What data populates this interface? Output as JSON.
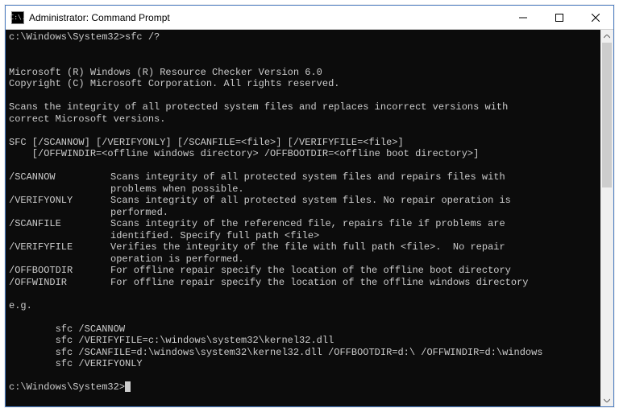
{
  "window": {
    "title": "Administrator: Command Prompt",
    "icon_text": "C:\\."
  },
  "prompt1": {
    "path": "c:\\Windows\\System32>",
    "cmd": "sfc /?"
  },
  "header": {
    "line1": "Microsoft (R) Windows (R) Resource Checker Version 6.0",
    "line2": "Copyright (C) Microsoft Corporation. All rights reserved."
  },
  "description": "Scans the integrity of all protected system files and replaces incorrect versions with\ncorrect Microsoft versions.",
  "usage": {
    "line1": "SFC [/SCANNOW] [/VERIFYONLY] [/SCANFILE=<file>] [/VERIFYFILE=<file>]",
    "line2": "    [/OFFWINDIR=<offline windows directory> /OFFBOOTDIR=<offline boot directory>]"
  },
  "options": [
    {
      "key": "/SCANNOW",
      "desc": "Scans integrity of all protected system files and repairs files with\nproblems when possible."
    },
    {
      "key": "/VERIFYONLY",
      "desc": "Scans integrity of all protected system files. No repair operation is\nperformed."
    },
    {
      "key": "/SCANFILE",
      "desc": "Scans integrity of the referenced file, repairs file if problems are\nidentified. Specify full path <file>"
    },
    {
      "key": "/VERIFYFILE",
      "desc": "Verifies the integrity of the file with full path <file>.  No repair\noperation is performed."
    },
    {
      "key": "/OFFBOOTDIR",
      "desc": "For offline repair specify the location of the offline boot directory"
    },
    {
      "key": "/OFFWINDIR",
      "desc": "For offline repair specify the location of the offline windows directory"
    }
  ],
  "example_heading": "e.g.",
  "examples": [
    "        sfc /SCANNOW",
    "        sfc /VERIFYFILE=c:\\windows\\system32\\kernel32.dll",
    "        sfc /SCANFILE=d:\\windows\\system32\\kernel32.dll /OFFBOOTDIR=d:\\ /OFFWINDIR=d:\\windows",
    "        sfc /VERIFYONLY"
  ],
  "prompt2": {
    "path": "c:\\Windows\\System32>"
  }
}
